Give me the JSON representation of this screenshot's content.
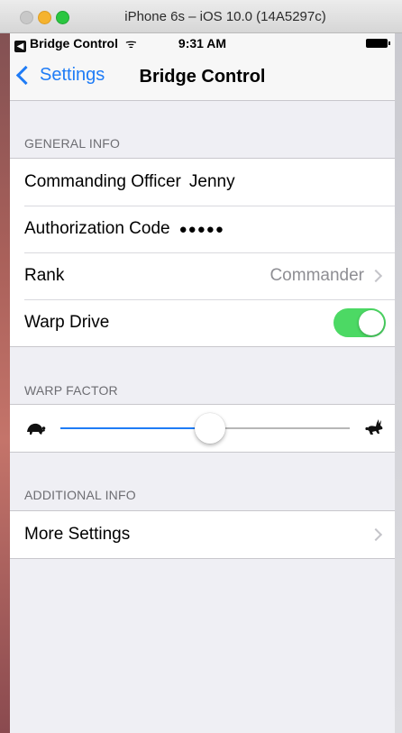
{
  "window": {
    "title": "iPhone 6s – iOS 10.0 (14A5297c)"
  },
  "status_bar": {
    "back_app": "Bridge Control",
    "back_glyph": "◀",
    "wifi": "ᯤ",
    "time": "9:31 AM"
  },
  "nav": {
    "back_label": "Settings",
    "title": "Bridge Control"
  },
  "general_info": {
    "header": "GENERAL INFO",
    "commanding_officer_label": "Commanding Officer",
    "commanding_officer_value": "Jenny",
    "authorization_code_label": "Authorization Code",
    "authorization_code_value": "●●●●●",
    "rank_label": "Rank",
    "rank_value": "Commander",
    "warp_drive_label": "Warp Drive",
    "warp_drive_on": true
  },
  "warp_factor": {
    "header": "WARP FACTOR",
    "value_fraction": 0.52,
    "min_icon": "turtle-icon",
    "max_icon": "rabbit-icon"
  },
  "additional_info": {
    "header": "ADDITIONAL INFO",
    "more_settings_label": "More Settings"
  },
  "colors": {
    "tint": "#1f7cf6",
    "switch_on": "#4cd964",
    "group_background": "#efeff4",
    "secondary_text": "#8e8e93"
  }
}
